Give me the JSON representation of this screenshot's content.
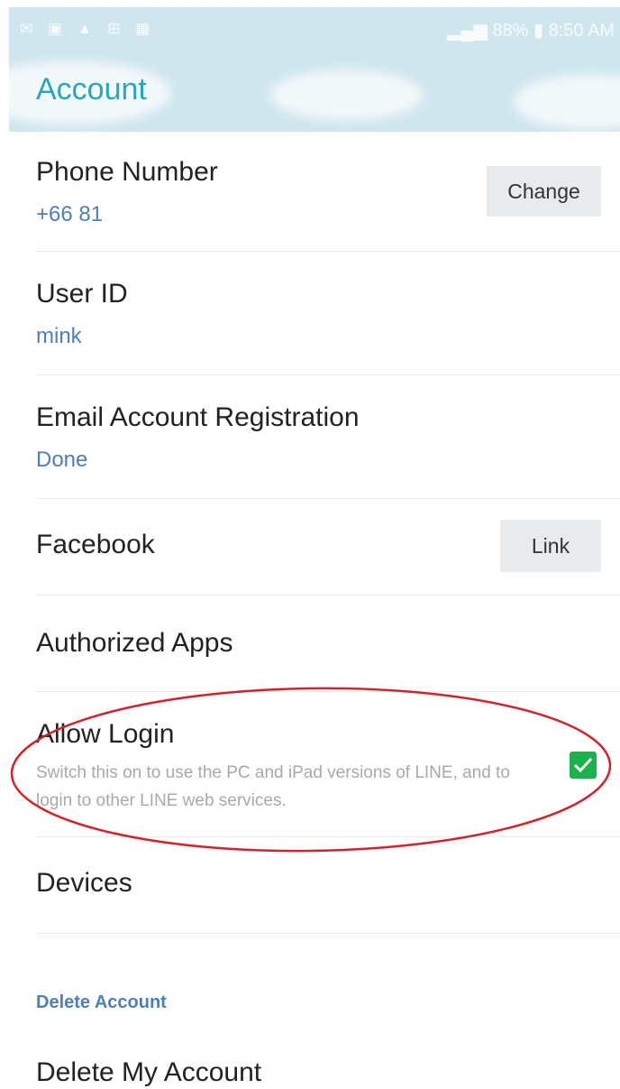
{
  "status_bar": {
    "left_icons": "✉ ▣ ▲ ⊞ ▦",
    "battery": "88%",
    "time": "8:50 AM"
  },
  "header": {
    "title": "Account"
  },
  "settings": {
    "phone": {
      "title": "Phone Number",
      "value": "+66 81",
      "button": "Change"
    },
    "user_id": {
      "title": "User ID",
      "value": "mink"
    },
    "email": {
      "title": "Email Account Registration",
      "value": "Done"
    },
    "facebook": {
      "title": "Facebook",
      "button": "Link"
    },
    "authorized_apps": {
      "title": "Authorized Apps"
    },
    "allow_login": {
      "title": "Allow Login",
      "description": "Switch this on to use the PC and iPad versions of LINE, and to login to other LINE web services.",
      "checked": true
    },
    "devices": {
      "title": "Devices"
    }
  },
  "delete_section": {
    "label": "Delete Account",
    "item": "Delete My Account"
  },
  "colors": {
    "accent_teal": "#2aa6b4",
    "link_blue": "#4f7fb5",
    "check_green": "#1cb24b",
    "annotation_red": "#d2232a"
  }
}
